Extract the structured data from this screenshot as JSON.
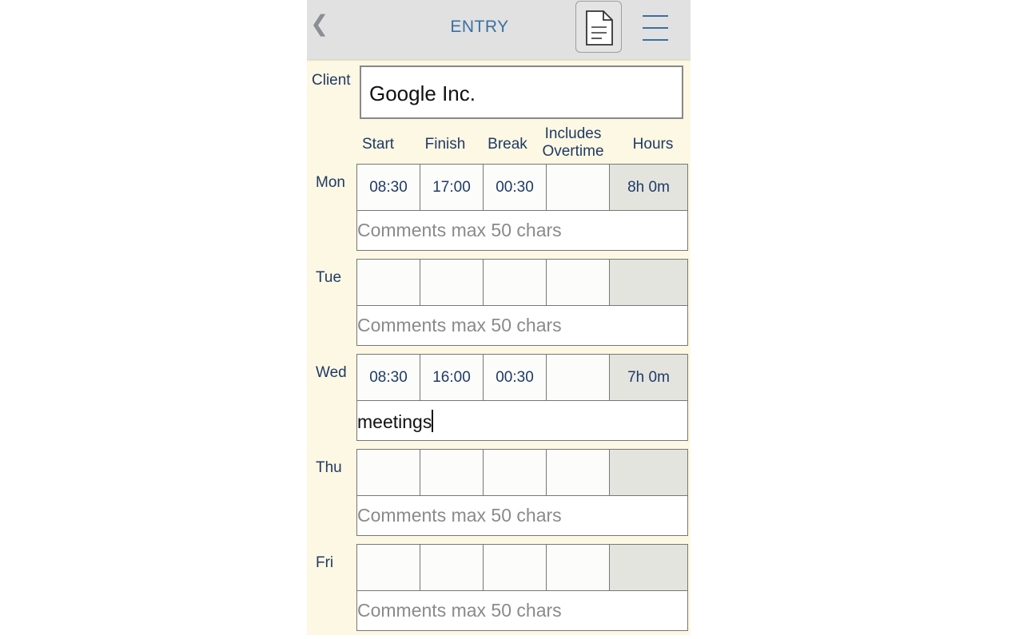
{
  "header": {
    "back_glyph": "❮",
    "title": "ENTRY",
    "report_icon": "document-icon",
    "menu_icon": "hamburger-menu-icon"
  },
  "client": {
    "label": "Client",
    "value": "Google Inc."
  },
  "columns": {
    "start": "Start",
    "finish": "Finish",
    "break": "Break",
    "overtime_line1": "Includes",
    "overtime_line2": "Overtime",
    "hours": "Hours"
  },
  "comment_placeholder": "Comments max 50 chars",
  "days": [
    {
      "label": "Mon",
      "start": "08:30",
      "finish": "17:00",
      "break": "00:30",
      "overtime": "",
      "hours": "8h 0m",
      "comment": ""
    },
    {
      "label": "Tue",
      "start": "",
      "finish": "",
      "break": "",
      "overtime": "",
      "hours": "",
      "comment": ""
    },
    {
      "label": "Wed",
      "start": "08:30",
      "finish": "16:00",
      "break": "00:30",
      "overtime": "",
      "hours": "7h 0m",
      "comment": "meetings"
    },
    {
      "label": "Thu",
      "start": "",
      "finish": "",
      "break": "",
      "overtime": "",
      "hours": "",
      "comment": ""
    },
    {
      "label": "Fri",
      "start": "",
      "finish": "",
      "break": "",
      "overtime": "",
      "hours": "",
      "comment": ""
    }
  ],
  "colors": {
    "background": "#fdf8e3",
    "topbar": "#e1e1e1",
    "accent": "#3b6fa3",
    "text": "#1f3a66",
    "hours_cell": "#e4e4de"
  }
}
